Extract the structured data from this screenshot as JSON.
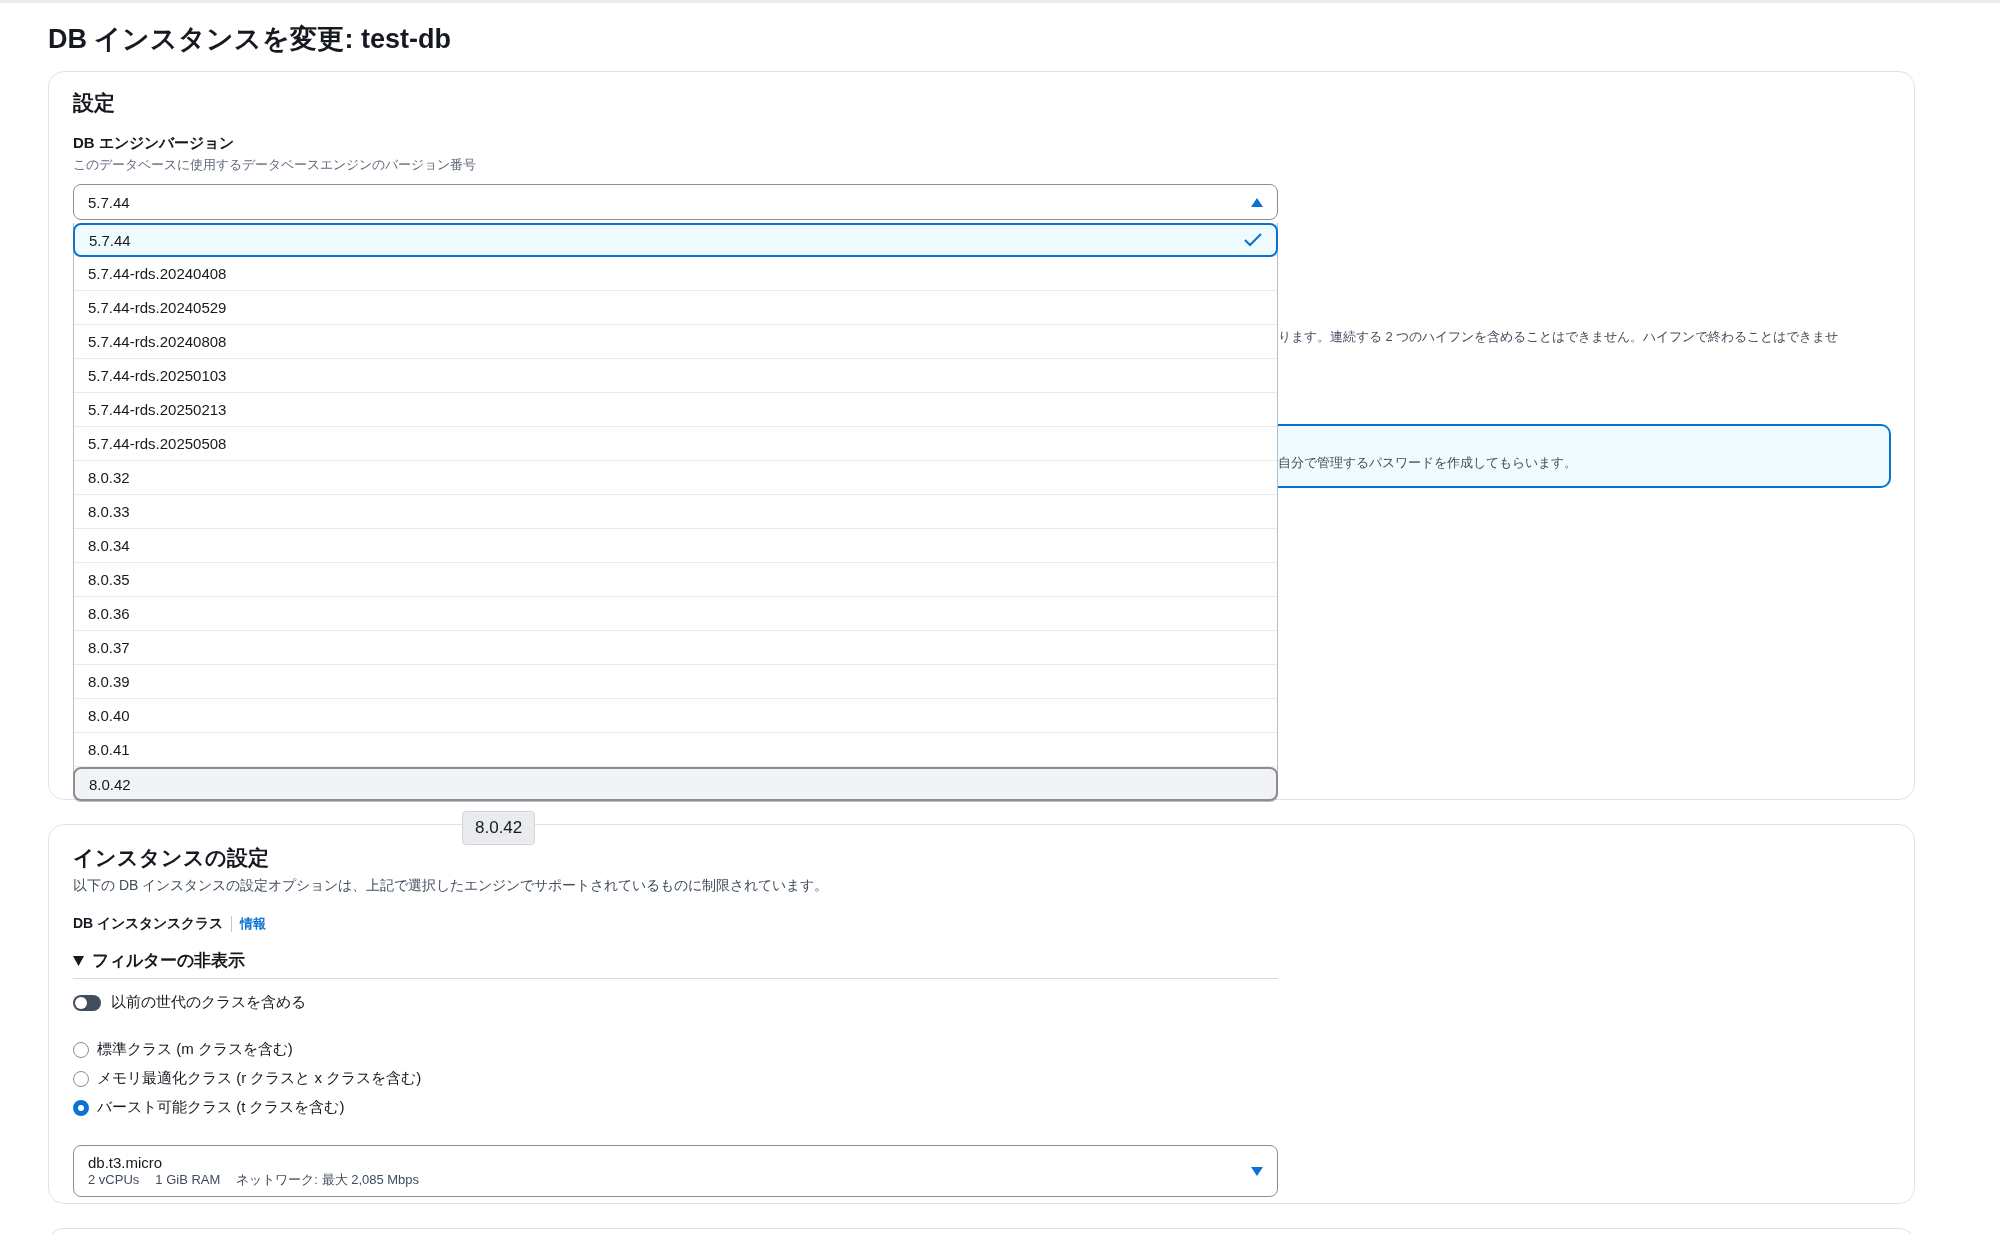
{
  "page_title": "DB インスタンスを変更: test-db",
  "settings": {
    "heading": "設定",
    "engine_version": {
      "label": "DB エンジンバージョン",
      "description": "このデータベースに使用するデータベースエンジンのバージョン番号",
      "value": "5.7.44",
      "expanded": true,
      "options": [
        {
          "label": "5.7.44",
          "selected": true,
          "highlighted": false
        },
        {
          "label": "5.7.44-rds.20240408",
          "selected": false,
          "highlighted": false
        },
        {
          "label": "5.7.44-rds.20240529",
          "selected": false,
          "highlighted": false
        },
        {
          "label": "5.7.44-rds.20240808",
          "selected": false,
          "highlighted": false
        },
        {
          "label": "5.7.44-rds.20250103",
          "selected": false,
          "highlighted": false
        },
        {
          "label": "5.7.44-rds.20250213",
          "selected": false,
          "highlighted": false
        },
        {
          "label": "5.7.44-rds.20250508",
          "selected": false,
          "highlighted": false
        },
        {
          "label": "8.0.32",
          "selected": false,
          "highlighted": false
        },
        {
          "label": "8.0.33",
          "selected": false,
          "highlighted": false
        },
        {
          "label": "8.0.34",
          "selected": false,
          "highlighted": false
        },
        {
          "label": "8.0.35",
          "selected": false,
          "highlighted": false
        },
        {
          "label": "8.0.36",
          "selected": false,
          "highlighted": false
        },
        {
          "label": "8.0.37",
          "selected": false,
          "highlighted": false
        },
        {
          "label": "8.0.39",
          "selected": false,
          "highlighted": false
        },
        {
          "label": "8.0.40",
          "selected": false,
          "highlighted": false
        },
        {
          "label": "8.0.41",
          "selected": false,
          "highlighted": false
        },
        {
          "label": "8.0.42",
          "selected": false,
          "highlighted": true
        }
      ]
    },
    "partial_hint": "ります。連続する 2 つのハイフンを含めることはできません。ハイフンで終わることはできませ",
    "partial_info": "自分で管理するパスワードを作成してもらいます。"
  },
  "tooltip": "8.0.42",
  "instance": {
    "heading": "インスタンスの設定",
    "description": "以下の DB インスタンスの設定オプションは、上記で選択したエンジンでサポートされているものに制限されています。",
    "class_label": "DB インスタンスクラス",
    "info_link": "情報",
    "filter_toggle": {
      "label": "フィルターの非表示",
      "expanded": true
    },
    "previous_gen": {
      "label": "以前の世代のクラスを含める",
      "on": false
    },
    "class_options": [
      {
        "label": "標準クラス (m クラスを含む)",
        "selected": false
      },
      {
        "label": "メモリ最適化クラス (r クラスと x クラスを含む)",
        "selected": false
      },
      {
        "label": "バースト可能クラス (t クラスを含む)",
        "selected": true
      }
    ],
    "instance_select": {
      "value": "db.t3.micro",
      "specs": [
        "2 vCPUs",
        "1 GiB RAM",
        "ネットワーク: 最大 2,085 Mbps"
      ]
    }
  }
}
